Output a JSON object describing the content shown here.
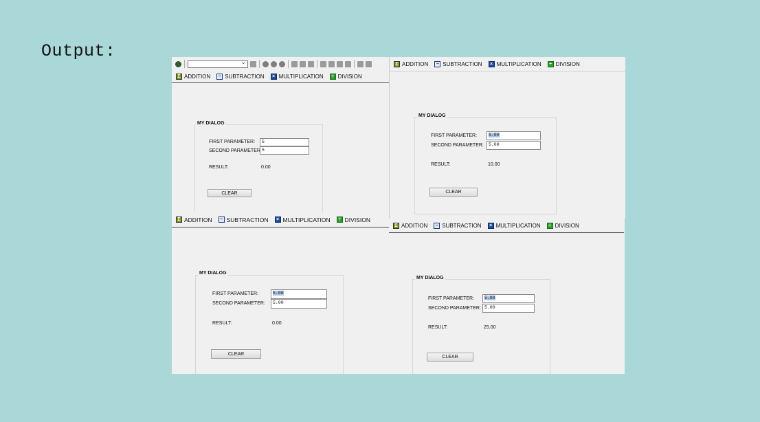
{
  "output_label": "Output:",
  "tabs": {
    "addition": "ADDITION",
    "subtraction": "SUBTRACTION",
    "multiplication": "MULTIPLICATION",
    "division": "DIVISION"
  },
  "dialog": {
    "title": "MY DIALOG",
    "first_label": "FIRST PARAMETER:",
    "second_label": "SECOND PARAMETER:",
    "result_label": "RESULT:",
    "clear_label": "CLEAR"
  },
  "panels": {
    "top_left": {
      "first": "5",
      "second": "5",
      "result": "0.00"
    },
    "top_right": {
      "first": "5.00",
      "second": "5.00",
      "result": "10.00"
    },
    "bottom_left": {
      "first": "5.00",
      "second": "5.00",
      "result": "0.00"
    },
    "bottom_right": {
      "first": "5.00",
      "second": "5.00",
      "result": "25.00"
    }
  },
  "icons": {
    "addition": "sigma-icon",
    "subtraction": "subtract-icon",
    "multiplication": "multiply-icon",
    "division": "divide-icon"
  },
  "colors": {
    "background": "#aad8d9",
    "panel": "#f0f0f0",
    "selection": "#a9c4e6"
  }
}
